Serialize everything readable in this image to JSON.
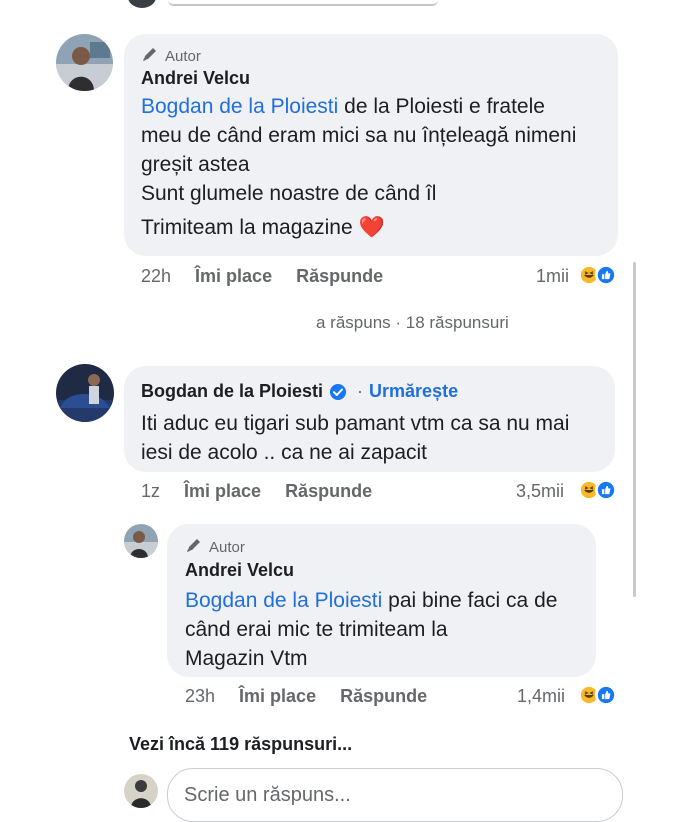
{
  "comment1": {
    "badge": "Autor",
    "name": "Andrei Velcu",
    "mention": "Bogdan de la Ploiesti",
    "line1_rest": " de la Ploiesti e fratele",
    "line2": "meu de când eram mici sa nu înțeleagă nimeni",
    "line3": "greșit astea",
    "line4": "Sunt glumele noastre de când îl",
    "line5": "Trimiteam la magazine",
    "heart": "❤️",
    "time": "22h",
    "like_label": "Îmi place",
    "reply_label": "Răspunde",
    "reactions": "1mii"
  },
  "replies_summary": "a răspuns · 18 răspunsuri",
  "comment2": {
    "name": "Bogdan de la Ploiesti",
    "separator": "·",
    "follow_label": "Urmărește",
    "line1": "Iti aduc eu tigari sub pamant vtm ca sa nu mai",
    "line2": "iesi de acolo .. ca ne ai zapacit",
    "time": "1z",
    "like_label": "Îmi place",
    "reply_label": "Răspunde",
    "reactions": "3,5mii"
  },
  "comment3": {
    "badge": "Autor",
    "name": "Andrei Velcu",
    "mention": "Bogdan de la Ploiesti",
    "line1_rest": " pai bine faci ca de",
    "line2": "când erai mic te trimiteam la",
    "line3": "Magazin Vtm",
    "time": "23h",
    "like_label": "Îmi place",
    "reply_label": "Răspunde",
    "reactions": "1,4mii"
  },
  "more_replies": "Vezi încă 119 răspunsuri...",
  "reply_input": {
    "placeholder": "Scrie un răspuns..."
  },
  "icons": {
    "author": "pen-icon",
    "verified": "verified-check-icon",
    "haha": "haha-reaction-icon",
    "like": "like-reaction-icon"
  },
  "colors": {
    "link": "#216fdb",
    "bubble": "#eff1f5",
    "meta": "#65676b",
    "haha": "#f7b928",
    "like": "#1877f2"
  }
}
